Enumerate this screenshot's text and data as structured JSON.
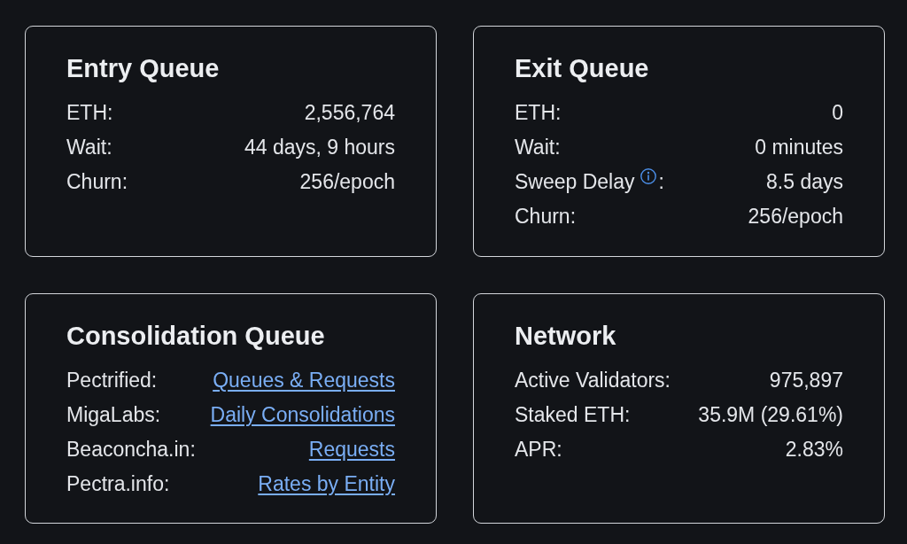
{
  "cards": [
    {
      "title": "Entry Queue",
      "rows": [
        {
          "kind": "text",
          "label": "ETH:",
          "value": "2,556,764"
        },
        {
          "kind": "text",
          "label": "Wait:",
          "value": "44 days, 9 hours"
        },
        {
          "kind": "text",
          "label": "Churn:",
          "value": "256/epoch"
        }
      ]
    },
    {
      "title": "Exit Queue",
      "rows": [
        {
          "kind": "text",
          "label": "ETH:",
          "value": "0"
        },
        {
          "kind": "text",
          "label": "Wait:",
          "value": "0 minutes"
        },
        {
          "kind": "text",
          "label": "Sweep Delay",
          "info_icon": true,
          "label_tail": ":",
          "value": "8.5 days"
        },
        {
          "kind": "text",
          "label": "Churn:",
          "value": "256/epoch"
        }
      ]
    },
    {
      "title": "Consolidation Queue",
      "rows": [
        {
          "kind": "link",
          "label": "Pectrified:",
          "value": "Queues & Requests"
        },
        {
          "kind": "link",
          "label": "MigaLabs:",
          "value": "Daily Consolidations"
        },
        {
          "kind": "link",
          "label": "Beaconcha.in:",
          "value": "Requests"
        },
        {
          "kind": "link",
          "label": "Pectra.info:",
          "value": "Rates by Entity"
        }
      ]
    },
    {
      "title": "Network",
      "rows": [
        {
          "kind": "text",
          "label": "Active Validators:",
          "value": "975,897"
        },
        {
          "kind": "text",
          "label": "Staked ETH:",
          "value": "35.9M (29.61%)"
        },
        {
          "kind": "text",
          "label": "APR:",
          "value": "2.83%"
        }
      ]
    }
  ]
}
